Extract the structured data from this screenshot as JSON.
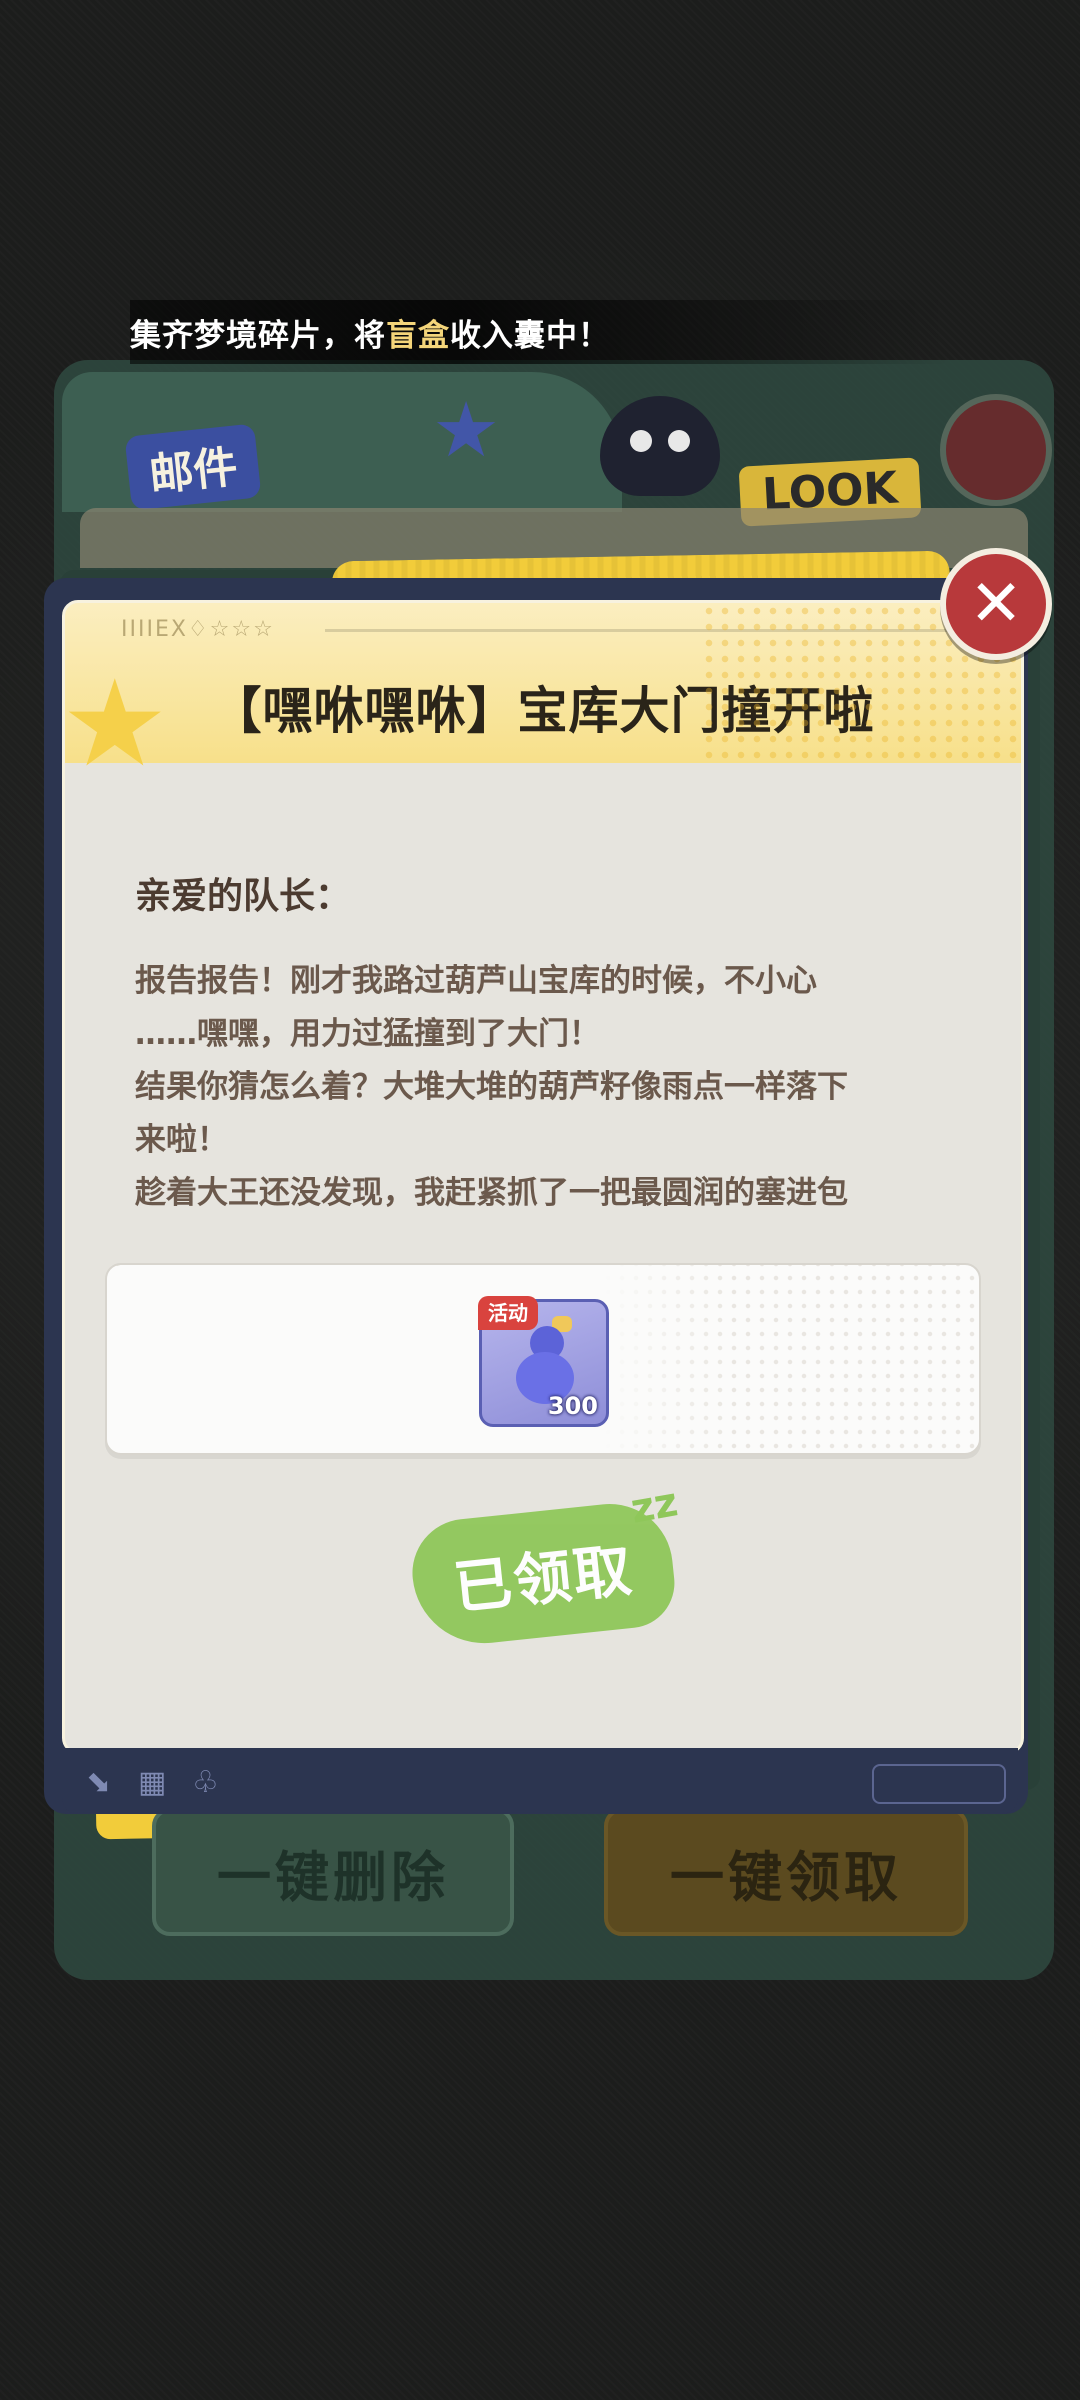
{
  "marquee": {
    "prefix": "集齐梦境碎片，将",
    "highlight": "盲盒",
    "suffix": "收入囊中！"
  },
  "mail_panel": {
    "title": "邮件",
    "badge": "LOOK",
    "delete_all_label": "一键删除",
    "claim_all_label": "一键领取"
  },
  "dialog": {
    "title": "【嘿咻嘿咻】宝库大门撞开啦",
    "greeting": "亲爱的队长：",
    "lines": [
      "报告报告！刚才我路过葫芦山宝库的时候，不小心",
      "……嘿嘿，用力过猛撞到了大门！",
      "结果你猜怎么着？大堆大堆的葫芦籽像雨点一样落下",
      "来啦！",
      "趁着大王还没发现，我赶紧抓了一把最圆润的塞进包"
    ],
    "reward": {
      "tag": "活动",
      "count": "300",
      "icon": "gourd-icon"
    },
    "claimed_label": "已领取",
    "close_icon": "close-icon"
  },
  "colors": {
    "accent_yellow": "#f7e08a",
    "close_red": "#b8393b",
    "stamp_green": "#8fc75a",
    "frame_navy": "#2c3550"
  }
}
